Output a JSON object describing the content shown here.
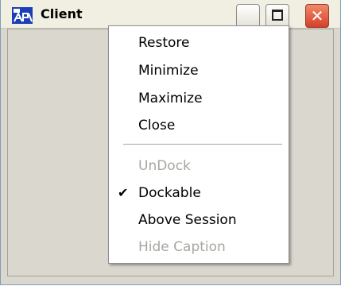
{
  "window": {
    "title": "Client",
    "icon": "app-window-icon",
    "title_buttons": [
      "minimize-icon",
      "maximize-icon",
      "close-icon"
    ],
    "close_glyph": "✕"
  },
  "context_menu": {
    "items": [
      {
        "label": "Restore",
        "enabled": true
      },
      {
        "label": "Minimize",
        "enabled": true
      },
      {
        "label": "Maximize",
        "enabled": true
      },
      {
        "label": "Close",
        "enabled": true
      }
    ],
    "items2": [
      {
        "label": "UnDock",
        "enabled": false
      },
      {
        "label": "Dockable",
        "enabled": true,
        "checked": true,
        "check_glyph": "✔"
      },
      {
        "label": "Above Session",
        "enabled": true
      },
      {
        "label": "Hide Caption",
        "enabled": false
      }
    ]
  },
  "colors": {
    "title_bg": "#f1efe2",
    "client_bg": "#d9d7ce",
    "close_button": "#d6402a",
    "disabled_text": "#a7a6a0"
  }
}
